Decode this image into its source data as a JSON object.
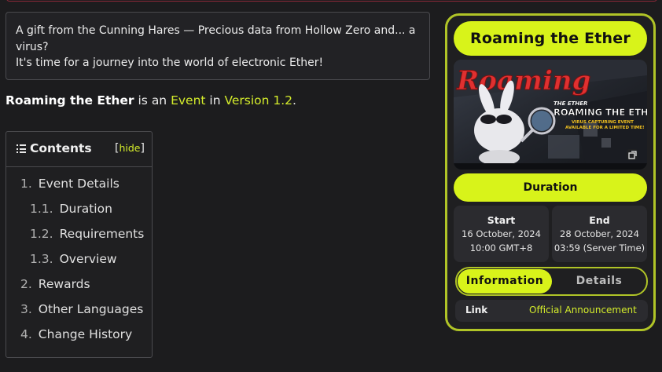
{
  "quote": {
    "line1": "A gift from the Cunning Hares — Precious data from Hollow Zero and... a virus?",
    "line2": "It's time for a journey into the world of electronic Ether!"
  },
  "intro": {
    "name": "Roaming the Ether",
    "is_an": " is an ",
    "event_link": "Event",
    "in": " in ",
    "version_link": "Version 1.2",
    "period": "."
  },
  "toc": {
    "title": "Contents",
    "bracket_open": "[",
    "hide_label": "hide",
    "bracket_close": "]",
    "items": [
      {
        "num": "1.",
        "label": "Event Details"
      },
      {
        "num": "1.1.",
        "label": "Duration"
      },
      {
        "num": "1.2.",
        "label": "Requirements"
      },
      {
        "num": "1.3.",
        "label": "Overview"
      },
      {
        "num": "2.",
        "label": "Rewards"
      },
      {
        "num": "3.",
        "label": "Other Languages"
      },
      {
        "num": "4.",
        "label": "Change History"
      }
    ]
  },
  "infobox": {
    "title": "Roaming the Ether",
    "banner": {
      "logo_text": "Roaming",
      "small_text": "THE ETHER",
      "big_text": "ROAMING THE ETHER",
      "sub1": "VIRUS CAPTURING EVENT",
      "sub2": "AVAILABLE FOR A LIMITED TIME!",
      "expand_icon": "gallery-expand-icon"
    },
    "duration_header": "Duration",
    "start": {
      "label": "Start",
      "date": "16 October, 2024",
      "time": "10:00 GMT+8"
    },
    "end": {
      "label": "End",
      "date": "28 October, 2024",
      "time": "03:59 (Server Time)"
    },
    "tabs": {
      "active": "Information",
      "inactive": "Details"
    },
    "link": {
      "key": "Link",
      "value": "Official Announcement"
    }
  },
  "colors": {
    "accent": "#d8f31a",
    "accent_border": "#b0c427",
    "link": "#d4ec2b",
    "background": "#1c1c1e",
    "panel": "#2b2b2f"
  }
}
